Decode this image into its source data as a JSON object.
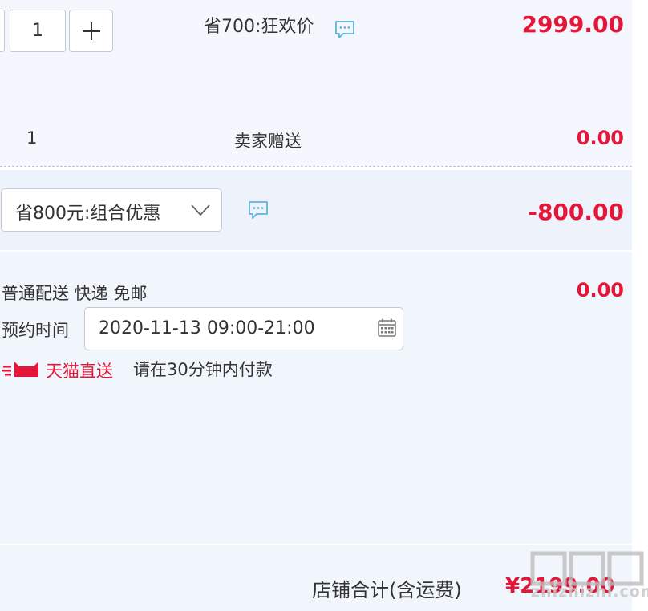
{
  "item": {
    "quantity": "1",
    "promo_label": "省700:狂欢价",
    "price": "2999.00"
  },
  "gift": {
    "quantity": "1",
    "label": "卖家赠送",
    "price": "0.00"
  },
  "combo": {
    "selected": "省800元:组合优惠",
    "price": "-800.00"
  },
  "shipping": {
    "label": "普通配送 快递 免邮",
    "price": "0.00",
    "time_label": "预约时间",
    "time_value": "2020-11-13 09:00-21:00",
    "tmall_direct": "天猫直送",
    "payment_note": "请在30分钟内付款"
  },
  "summary": {
    "total_label": "店铺合计(含运费)",
    "total_value": "¥2199.00"
  },
  "watermark": {
    "text": "zhizhizhi.com"
  },
  "colors": {
    "price_red": "#e4173a",
    "chat_icon_blue": "#5bb3de",
    "panel_bg": "#f4f7fd"
  },
  "icons": [
    "plus-icon",
    "chat-icon",
    "chevron-down-icon",
    "calendar-icon",
    "tmall-logo-icon"
  ]
}
